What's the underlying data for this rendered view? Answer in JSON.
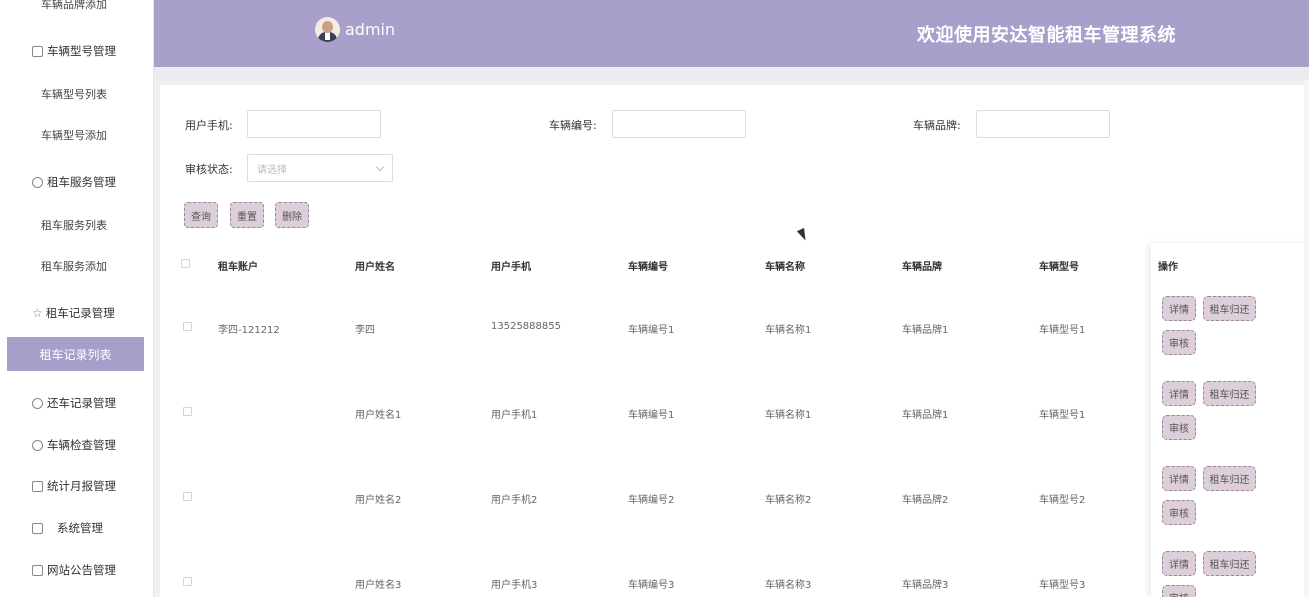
{
  "sidebar": {
    "items": [
      {
        "label": "车辆品牌添加",
        "type": "sub"
      },
      {
        "label": "车辆型号管理",
        "type": "group",
        "icon": "trash-icon"
      },
      {
        "label": "车辆型号列表",
        "type": "sub"
      },
      {
        "label": "车辆型号添加",
        "type": "sub"
      },
      {
        "label": "租车服务管理",
        "type": "group",
        "icon": "pie-icon"
      },
      {
        "label": "租车服务列表",
        "type": "sub"
      },
      {
        "label": "租车服务添加",
        "type": "sub"
      },
      {
        "label": "租车记录管理",
        "type": "group",
        "icon": "star-icon"
      },
      {
        "label": "租车记录列表",
        "type": "active"
      },
      {
        "label": "还车记录管理",
        "type": "group",
        "icon": "compass-icon"
      },
      {
        "label": "车辆检查管理",
        "type": "group",
        "icon": "timer-icon"
      },
      {
        "label": "统计月报管理",
        "type": "group",
        "icon": "calendar-check-icon"
      },
      {
        "label": "系统管理",
        "type": "group",
        "icon": "trash-icon"
      },
      {
        "label": "网站公告管理",
        "type": "group",
        "icon": "calendar-check-icon"
      }
    ]
  },
  "header": {
    "username": "admin",
    "title": "欢迎使用安达智能租车管理系统",
    "accent": "#a89fcb"
  },
  "filters": {
    "phone_label": "用户手机:",
    "car_no_label": "车辆编号:",
    "brand_label": "车辆品牌:",
    "status_label": "审核状态:",
    "status_placeholder": "请选择",
    "query_btn": "查询",
    "reset_btn": "重置",
    "delete_btn": "删除"
  },
  "table": {
    "headers": [
      "租车账户",
      "用户姓名",
      "用户手机",
      "车辆编号",
      "车辆名称",
      "车辆品牌",
      "车辆型号",
      "操作"
    ],
    "rows": [
      [
        "李四-121212",
        "李四",
        "13525888855",
        "车辆编号1",
        "车辆名称1",
        "车辆品牌1",
        "车辆型号1"
      ],
      [
        "",
        "用户姓名1",
        "用户手机1",
        "车辆编号1",
        "车辆名称1",
        "车辆品牌1",
        "车辆型号1"
      ],
      [
        "",
        "用户姓名2",
        "用户手机2",
        "车辆编号2",
        "车辆名称2",
        "车辆品牌2",
        "车辆型号2"
      ],
      [
        "",
        "用户姓名3",
        "用户手机3",
        "车辆编号3",
        "车辆名称3",
        "车辆品牌3",
        "车辆型号3"
      ]
    ],
    "actions": {
      "detail": "详情",
      "return": "租车归还",
      "audit": "审核"
    }
  }
}
